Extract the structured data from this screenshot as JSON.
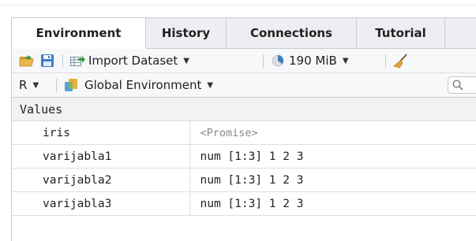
{
  "tabs": [
    {
      "label": "Environment",
      "active": true
    },
    {
      "label": "History",
      "active": false
    },
    {
      "label": "Connections",
      "active": false
    },
    {
      "label": "Tutorial",
      "active": false
    }
  ],
  "toolbar1": {
    "open_icon": "open-folder-icon",
    "save_icon": "save-disk-icon",
    "import_label": "Import Dataset",
    "memory_label": "190 MiB",
    "clear_icon": "broom-icon"
  },
  "toolbar2": {
    "language_label": "R",
    "environment_label": "Global Environment",
    "search_icon": "search-icon"
  },
  "values_header": "Values",
  "rows": [
    {
      "name": "iris",
      "value": "<Promise>"
    },
    {
      "name": "varijabla1",
      "value": "num [1:3] 1 2 3"
    },
    {
      "name": "varijabla2",
      "value": "num [1:3] 1 2 3"
    },
    {
      "name": "varijabla3",
      "value": "num [1:3] 1 2 3"
    }
  ],
  "colors": {
    "tab_bar": "#eceef1",
    "toolbar": "#f7f8fa",
    "border": "#c9ccd0",
    "promise_text": "#8a8a8a"
  }
}
